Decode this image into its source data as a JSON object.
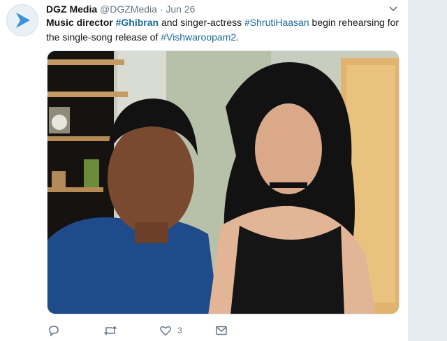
{
  "tweet": {
    "author_name": "DGZ Media",
    "author_handle": "@DGZMedia",
    "separator": "·",
    "date": "Jun 26",
    "text_parts": {
      "p1": "Music director",
      "p2": "#Ghibran",
      "p3": "and singer-actress",
      "p4": "#ShrutiHaasan",
      "p5": "begin rehearsing for the single-song release of",
      "p6": "#Vishwaroopam2",
      "p7": "."
    },
    "actions": {
      "reply_icon": "reply-icon",
      "retweet_icon": "retweet-icon",
      "like_icon": "heart-icon",
      "like_count": "3",
      "dm_icon": "envelope-icon"
    }
  },
  "colors": {
    "hashtag": "#1b6a9c",
    "muted": "#657786",
    "avatar_accent": "#3b94d9"
  }
}
